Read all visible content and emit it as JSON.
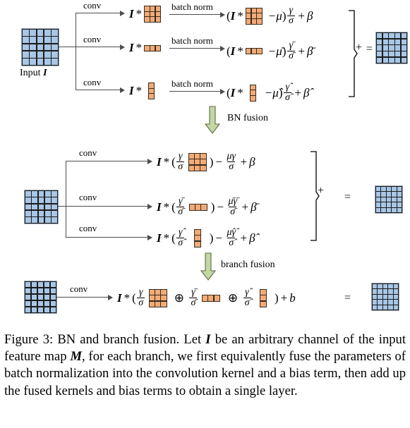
{
  "figure": {
    "number": "Figure 3",
    "caption_parts": {
      "lead": "Figure 3: BN and branch fusion. Let ",
      "sym_I": "I",
      "mid1": " be an arbitrary channel of the input feature map ",
      "sym_M": "M",
      "mid2": ", for each branch, we first equivalently fuse the parameters of batch normalization into the convolution kernel and a bias term, then add up the fused kernels and bias terms to obtain a single layer."
    }
  },
  "colors": {
    "input_map": "#a8c6e5",
    "kernel": "#f0ab78",
    "grid_line": "#1b1b1b",
    "arrow": "#4d4d4d",
    "fusion_arrow_fill": "#c4d6a4",
    "fusion_arrow_stroke": "#5a6b3f"
  },
  "stage1": {
    "input_label_text": "Input ",
    "input_label_symbol": "I",
    "branches": [
      {
        "conv_label": "conv",
        "bn_label": "batch norm",
        "kernel": "3x3",
        "pre_bn": {
          "I": "I",
          "star": "*"
        },
        "post_bn": {
          "open": "(",
          "I": "I",
          "star": "*",
          "minus_mu": "−μ",
          "close": ")",
          "frac_num": "γ",
          "frac_den": "σ",
          "plus": "+",
          "beta": "β"
        }
      },
      {
        "conv_label": "conv",
        "bn_label": "batch norm",
        "kernel": "1x3",
        "pre_bn": {
          "I": "I",
          "star": "*"
        },
        "post_bn": {
          "open": "(",
          "I": "I",
          "star": "*",
          "minus_mu": "−μ̄",
          "close": ")",
          "frac_num": "γ̄",
          "frac_den": "σ̄",
          "plus": "+",
          "beta": "β̄"
        }
      },
      {
        "conv_label": "conv",
        "bn_label": "batch norm",
        "kernel": "3x1",
        "pre_bn": {
          "I": "I",
          "star": "*"
        },
        "post_bn": {
          "open": "(",
          "I": "I",
          "star": "*",
          "minus_mu": "−μ̂",
          "close": ")",
          "frac_num": "γ̂",
          "frac_den": "σ̂",
          "plus": "+",
          "beta": "β̂"
        }
      }
    ],
    "combine_symbol": "+",
    "equals_symbol": "="
  },
  "fusion1": {
    "label": "BN fusion"
  },
  "stage2": {
    "branches": [
      {
        "conv_label": "conv",
        "kernel": "3x3",
        "expr": {
          "I": "I",
          "star": "*",
          "open": "(",
          "scale_num": "γ",
          "scale_den": "σ",
          "close": ")",
          "minus": "−",
          "bias_num": "μγ",
          "bias_den": "σ",
          "plus": "+",
          "beta": "β"
        }
      },
      {
        "conv_label": "conv",
        "kernel": "1x3",
        "expr": {
          "I": "I",
          "star": "*",
          "open": "(",
          "scale_num": "γ̄",
          "scale_den": "σ̄",
          "close": ")",
          "minus": "−",
          "bias_num": "μ̄γ̄",
          "bias_den": "σ̄",
          "plus": "+",
          "beta": "β̄"
        }
      },
      {
        "conv_label": "conv",
        "kernel": "3x1",
        "expr": {
          "I": "I",
          "star": "*",
          "open": "(",
          "scale_num": "γ̂",
          "scale_den": "σ̂",
          "close": ")",
          "minus": "−",
          "bias_num": "μ̂γ̂",
          "bias_den": "σ̂",
          "plus": "+",
          "beta": "β̂"
        }
      }
    ],
    "combine_symbol": "+",
    "equals_symbol": "="
  },
  "fusion2": {
    "label": "branch fusion"
  },
  "stage3": {
    "conv_label": "conv",
    "expr": {
      "I": "I",
      "star": "*",
      "open": "(",
      "s1_num": "γ",
      "s1_den": "σ",
      "oplus1": "⊕",
      "s2_num": "γ̄",
      "s2_den": "σ̄",
      "oplus2": "⊕",
      "s3_num": "γ̂",
      "s3_den": "σ̂",
      "close": ")",
      "plus": "+",
      "bias": "b"
    },
    "equals_symbol": "="
  }
}
